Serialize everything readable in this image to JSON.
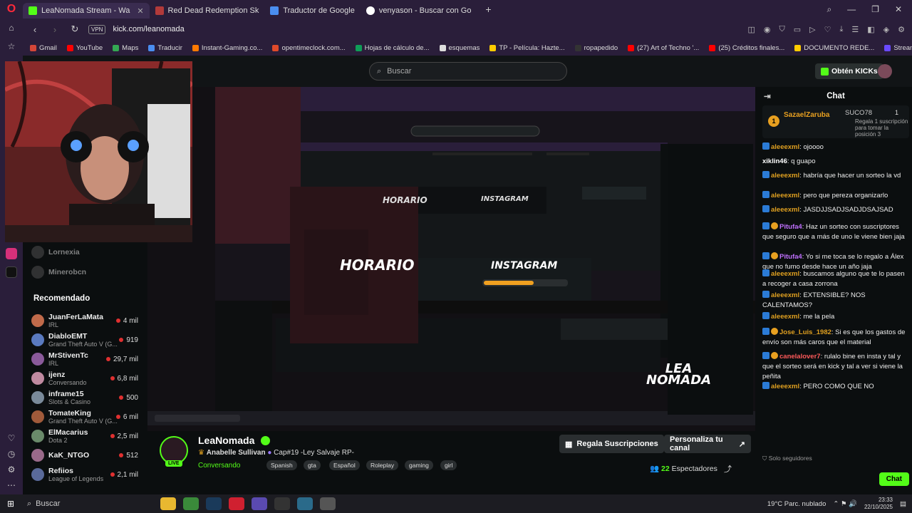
{
  "browser": {
    "tabs": [
      {
        "label": "LeaNomada Stream - Wa",
        "active": true,
        "color": "#53fc18"
      },
      {
        "label": "Red Dead Redemption Sk",
        "active": false,
        "color": "#b23a3a"
      },
      {
        "label": "Traductor de Google",
        "active": false,
        "color": "#4a8ef0"
      },
      {
        "label": "venyason - Buscar con Go",
        "active": false,
        "color": "#ffffff"
      }
    ],
    "url": "kick.com/leanomada",
    "vpn_label": "VPN",
    "bookmarks": [
      {
        "label": "Gmail",
        "color": "#d44638"
      },
      {
        "label": "YouTube",
        "color": "#ff0000"
      },
      {
        "label": "Maps",
        "color": "#34a853"
      },
      {
        "label": "Traducir",
        "color": "#4a8ef0"
      },
      {
        "label": "Instant-Gaming.co...",
        "color": "#ff7a00"
      },
      {
        "label": "opentimeclock.com...",
        "color": "#e04a2a"
      },
      {
        "label": "Hojas de cálculo de...",
        "color": "#0f9d58"
      },
      {
        "label": "esquemas",
        "color": "#dddddd"
      },
      {
        "label": "TP - Película: Hazte...",
        "color": "#ffcc00"
      },
      {
        "label": "ropapedido",
        "color": "#333333"
      },
      {
        "label": "(27) Art of Techno '...",
        "color": "#ff0000"
      },
      {
        "label": "(25) Créditos finales...",
        "color": "#ff0000"
      },
      {
        "label": "DOCUMENTO REDE...",
        "color": "#ffcc00"
      },
      {
        "label": "StreamElements - O...",
        "color": "#6a4aff"
      }
    ]
  },
  "kick": {
    "search_placeholder": "Buscar",
    "kicks_button": "Obtén KICKs",
    "sidebar": {
      "offline": [
        {
          "name": "Lornexia"
        },
        {
          "name": "Minerobcn"
        }
      ],
      "heading": "Recomendado",
      "items": [
        {
          "name": "JuanFerLaMata",
          "sub": "IRL",
          "count": "4 mil"
        },
        {
          "name": "DiabloEMT",
          "sub": "Grand Theft Auto V (G...",
          "count": "919"
        },
        {
          "name": "MrStivenTc",
          "sub": "IRL",
          "count": "29,7 mil"
        },
        {
          "name": "ijenz",
          "sub": "Conversando",
          "count": "6,8 mil"
        },
        {
          "name": "inframe15",
          "sub": "Slots & Casino",
          "count": "500"
        },
        {
          "name": "TomateKing",
          "sub": "Grand Theft Auto V (G...",
          "count": "6 mil"
        },
        {
          "name": "ElMacarius",
          "sub": "Dota 2",
          "count": "2,5 mil"
        },
        {
          "name": "KaK_NTGO",
          "sub": "",
          "count": "512"
        },
        {
          "name": "Refiios",
          "sub": "League of Legends",
          "count": "2,1 mil"
        }
      ]
    },
    "overlay": {
      "schedule": "HORARIO",
      "instagram": "INSTAGRAM",
      "logo_line1": "LEA",
      "logo_line2": "NOMADA"
    },
    "stream": {
      "name": "LeaNomada",
      "live": "LIVE",
      "title_prefix": "Anabelle Sullivan",
      "title": "Cap#19 -Ley Salvaje RP-",
      "category": "Conversando",
      "tags": [
        "Spanish",
        "gta",
        "Español",
        "Roleplay",
        "gaming",
        "girl"
      ],
      "subs_button": "Regala Suscripciones",
      "customize_button": "Personaliza tu canal",
      "viewers_count": "22",
      "viewers_label": "Espectadores"
    },
    "chat": {
      "title": "Chat",
      "pinned": {
        "user": "SazaelZaruba",
        "rank_user": "SUCO78",
        "rank_count": "1",
        "text": "Regala 1 suscripción para tomar la posición 3"
      },
      "messages": [
        {
          "user": "aleeexml",
          "text": "ojoooo",
          "color": "#e0a020"
        },
        {
          "user": "xiklin46",
          "text": "q guapo",
          "color": "#ffffff"
        },
        {
          "user": "aleeexml",
          "text": "habría que hacer un sorteo la vd",
          "color": "#e0a020"
        },
        {
          "user": "aleeexml",
          "text": "pero que pereza organizarlo",
          "color": "#e0a020"
        },
        {
          "user": "aleeexml",
          "text": "JASDJJSADJSADJDSAJSAD",
          "color": "#e0a020"
        },
        {
          "user": "Pitufa4",
          "text": "Haz un sorteo con suscriptores que seguro que a más de uno le viene bien jaja",
          "color": "#c070ff"
        },
        {
          "user": "Pitufa4",
          "text": "Yo si me toca se lo regalo a Álex que no fumo desde hace un año jaja",
          "color": "#c070ff"
        },
        {
          "user": "aleeexml",
          "text": "buscamos alguno que te lo pasen a recoger a casa zorrona",
          "color": "#e0a020"
        },
        {
          "user": "aleeexml",
          "text": "EXTENSIBLE? NOS CALENTAMOS?",
          "color": "#e0a020"
        },
        {
          "user": "aleeexml",
          "text": "me la pela",
          "color": "#e0a020"
        },
        {
          "user": "Jose_Luis_1982",
          "text": "Si es que los gastos de envío son más caros que el material",
          "color": "#e0a020"
        },
        {
          "user": "canelalover7",
          "text": "rulalo bine en insta y tal y que el sorteo será en kick y tal a ver si viene la peñita",
          "color": "#ff5a5a"
        },
        {
          "user": "aleeexml",
          "text": "PERO COMO QUE NO",
          "color": "#e0a020"
        }
      ],
      "followers_only": "Solo seguidores",
      "send": "Chat"
    }
  },
  "taskbar": {
    "search": "Buscar",
    "weather": "19°C Parc. nublado",
    "time": "23:33",
    "date": "22/10/2025"
  }
}
